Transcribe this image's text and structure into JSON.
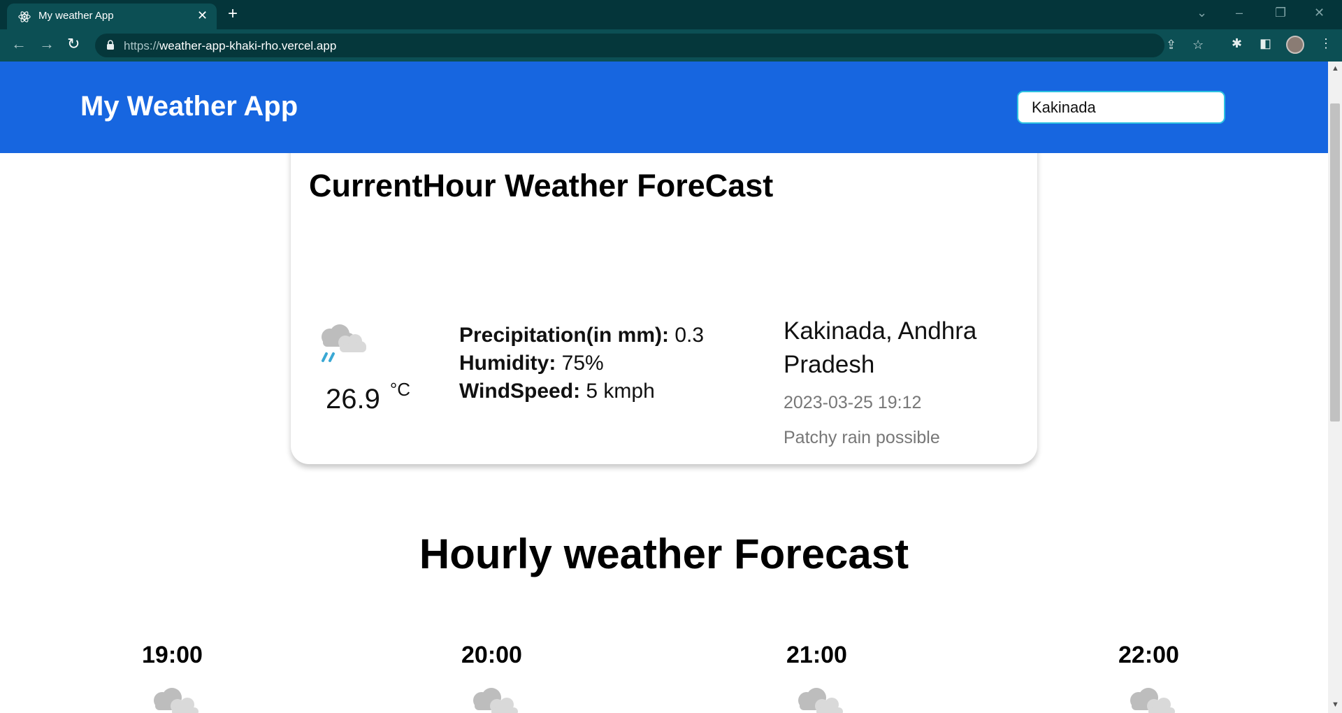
{
  "browser": {
    "tab_title": "My weather App",
    "tab_close": "✕",
    "new_tab": "+",
    "url_scheme": "https://",
    "url_host": "weather-app-khaki-rho.vercel.app",
    "controls": {
      "chevron": "⌄",
      "minimize": "–",
      "restore": "❐",
      "close": "✕"
    },
    "nav": {
      "back": "←",
      "forward": "→",
      "reload": "↻"
    },
    "icons": {
      "share": "⇪",
      "bookmark": "☆",
      "extensions": "✱",
      "sidepanel": "◧",
      "menu": "⋮"
    }
  },
  "header": {
    "app_title": "My Weather App",
    "search_value": "Kakinada"
  },
  "current": {
    "title": "CurrentHour Weather ForeCast",
    "icon": "patchy-rain-cloud-icon",
    "temperature": "26.9",
    "unit": "°C",
    "stats": [
      {
        "label": "Precipitation(in mm):",
        "value": " 0.3"
      },
      {
        "label": "Humidity:",
        "value": " 75%"
      },
      {
        "label": "WindSpeed:",
        "value": " 5 kmph"
      }
    ],
    "location": "Kakinada, Andhra Pradesh",
    "datetime": "2023-03-25 19:12",
    "condition": "Patchy rain possible"
  },
  "hourly": {
    "title": "Hourly weather Forecast",
    "hours": [
      {
        "time": "19:00",
        "icon": "patchy-rain-cloud-icon"
      },
      {
        "time": "20:00",
        "icon": "patchy-rain-cloud-icon"
      },
      {
        "time": "21:00",
        "icon": "patchy-rain-cloud-icon"
      },
      {
        "time": "22:00",
        "icon": "patchy-rain-cloud-icon"
      }
    ]
  },
  "colors": {
    "header_bg": "#1766e0",
    "browser_frame": "#04353a",
    "search_border": "#2dc2e0",
    "rain_drops": "#3aa8d4"
  }
}
